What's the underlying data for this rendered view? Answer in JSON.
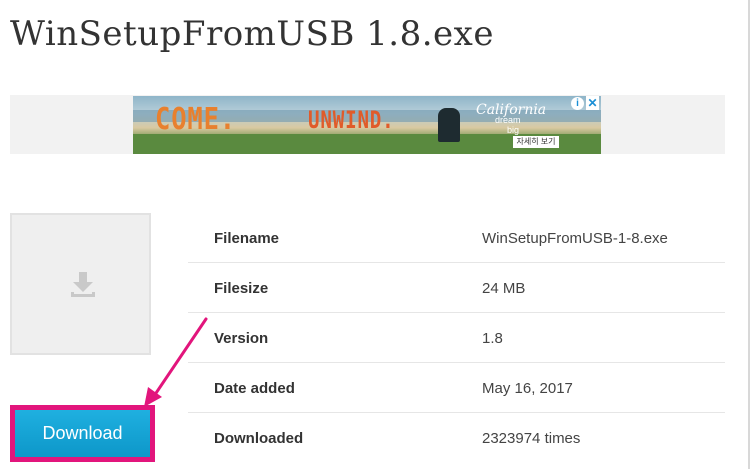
{
  "page": {
    "title": "WinSetupFromUSB 1.8.exe"
  },
  "ad": {
    "headline_1": "COME.",
    "headline_2": "UNWIND.",
    "brand": "California",
    "tagline_1": "dream",
    "tagline_2": "big",
    "cta": "자세히 보기",
    "info_glyph": "i",
    "close_glyph": "✕"
  },
  "thumbnail": {
    "icon": "download-icon"
  },
  "file_info": {
    "rows": [
      {
        "label": "Filename",
        "value": "WinSetupFromUSB-1-8.exe"
      },
      {
        "label": "Filesize",
        "value": "24 MB"
      },
      {
        "label": "Version",
        "value": "1.8"
      },
      {
        "label": "Date added",
        "value": "May 16, 2017"
      },
      {
        "label": "Downloaded",
        "value": "2323974 times"
      }
    ]
  },
  "download_button": {
    "label": "Download"
  },
  "colors": {
    "highlight": "#e2157c",
    "button": "#0d97c9"
  }
}
